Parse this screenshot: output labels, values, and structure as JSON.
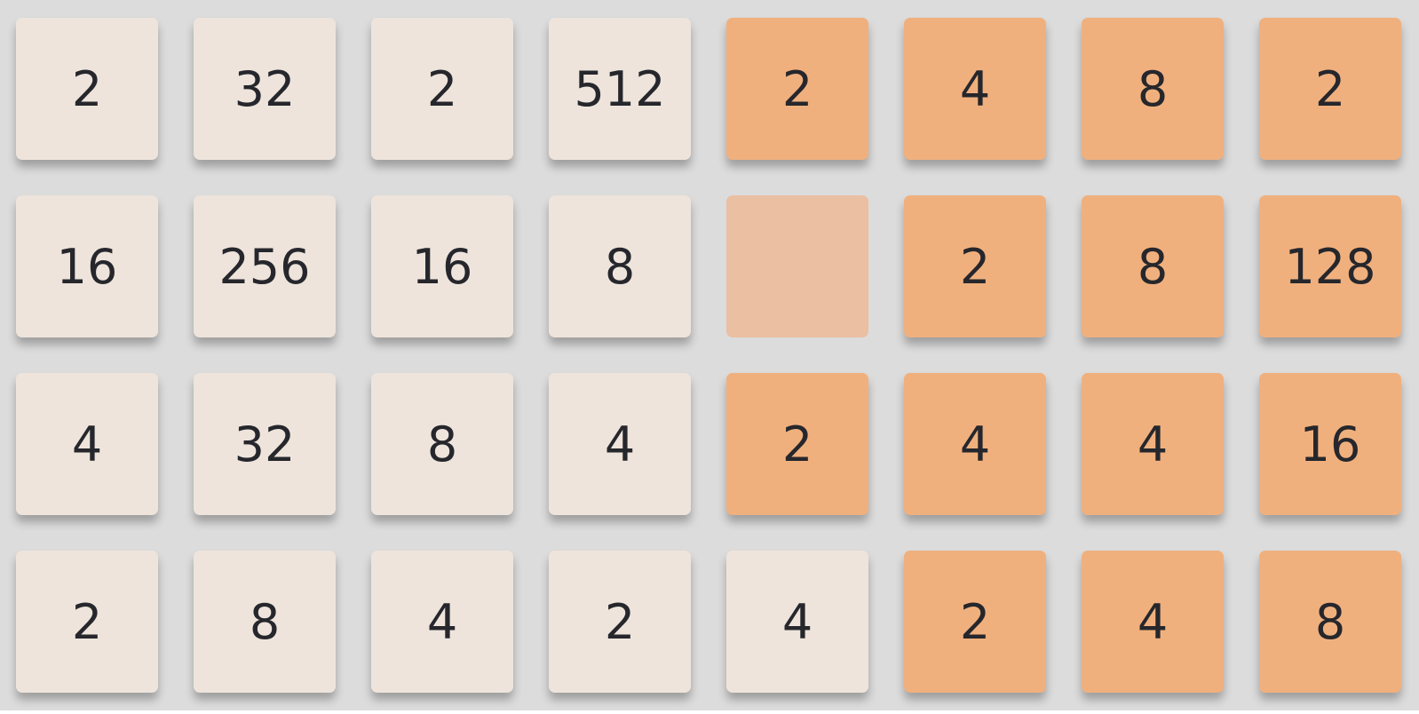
{
  "colors": {
    "board_background": "#dcdcdc",
    "tile_light": "#eee4dc",
    "tile_orange": "#f0b07d",
    "tile_empty": "#eabfa2",
    "text": "#26272c"
  },
  "grid": {
    "rows": 4,
    "cols": 8,
    "tiles": [
      [
        {
          "value": "2",
          "style": "light"
        },
        {
          "value": "32",
          "style": "light"
        },
        {
          "value": "2",
          "style": "light"
        },
        {
          "value": "512",
          "style": "light"
        },
        {
          "value": "2",
          "style": "orange"
        },
        {
          "value": "4",
          "style": "orange"
        },
        {
          "value": "8",
          "style": "orange"
        },
        {
          "value": "2",
          "style": "orange"
        }
      ],
      [
        {
          "value": "16",
          "style": "light"
        },
        {
          "value": "256",
          "style": "light"
        },
        {
          "value": "16",
          "style": "light"
        },
        {
          "value": "8",
          "style": "light"
        },
        {
          "value": "",
          "style": "empty"
        },
        {
          "value": "2",
          "style": "orange"
        },
        {
          "value": "8",
          "style": "orange"
        },
        {
          "value": "128",
          "style": "orange"
        }
      ],
      [
        {
          "value": "4",
          "style": "light"
        },
        {
          "value": "32",
          "style": "light"
        },
        {
          "value": "8",
          "style": "light"
        },
        {
          "value": "4",
          "style": "light"
        },
        {
          "value": "2",
          "style": "orange"
        },
        {
          "value": "4",
          "style": "orange"
        },
        {
          "value": "4",
          "style": "orange"
        },
        {
          "value": "16",
          "style": "orange"
        }
      ],
      [
        {
          "value": "2",
          "style": "light"
        },
        {
          "value": "8",
          "style": "light"
        },
        {
          "value": "4",
          "style": "light"
        },
        {
          "value": "2",
          "style": "light"
        },
        {
          "value": "4",
          "style": "light"
        },
        {
          "value": "2",
          "style": "orange"
        },
        {
          "value": "4",
          "style": "orange"
        },
        {
          "value": "8",
          "style": "orange"
        }
      ]
    ]
  }
}
